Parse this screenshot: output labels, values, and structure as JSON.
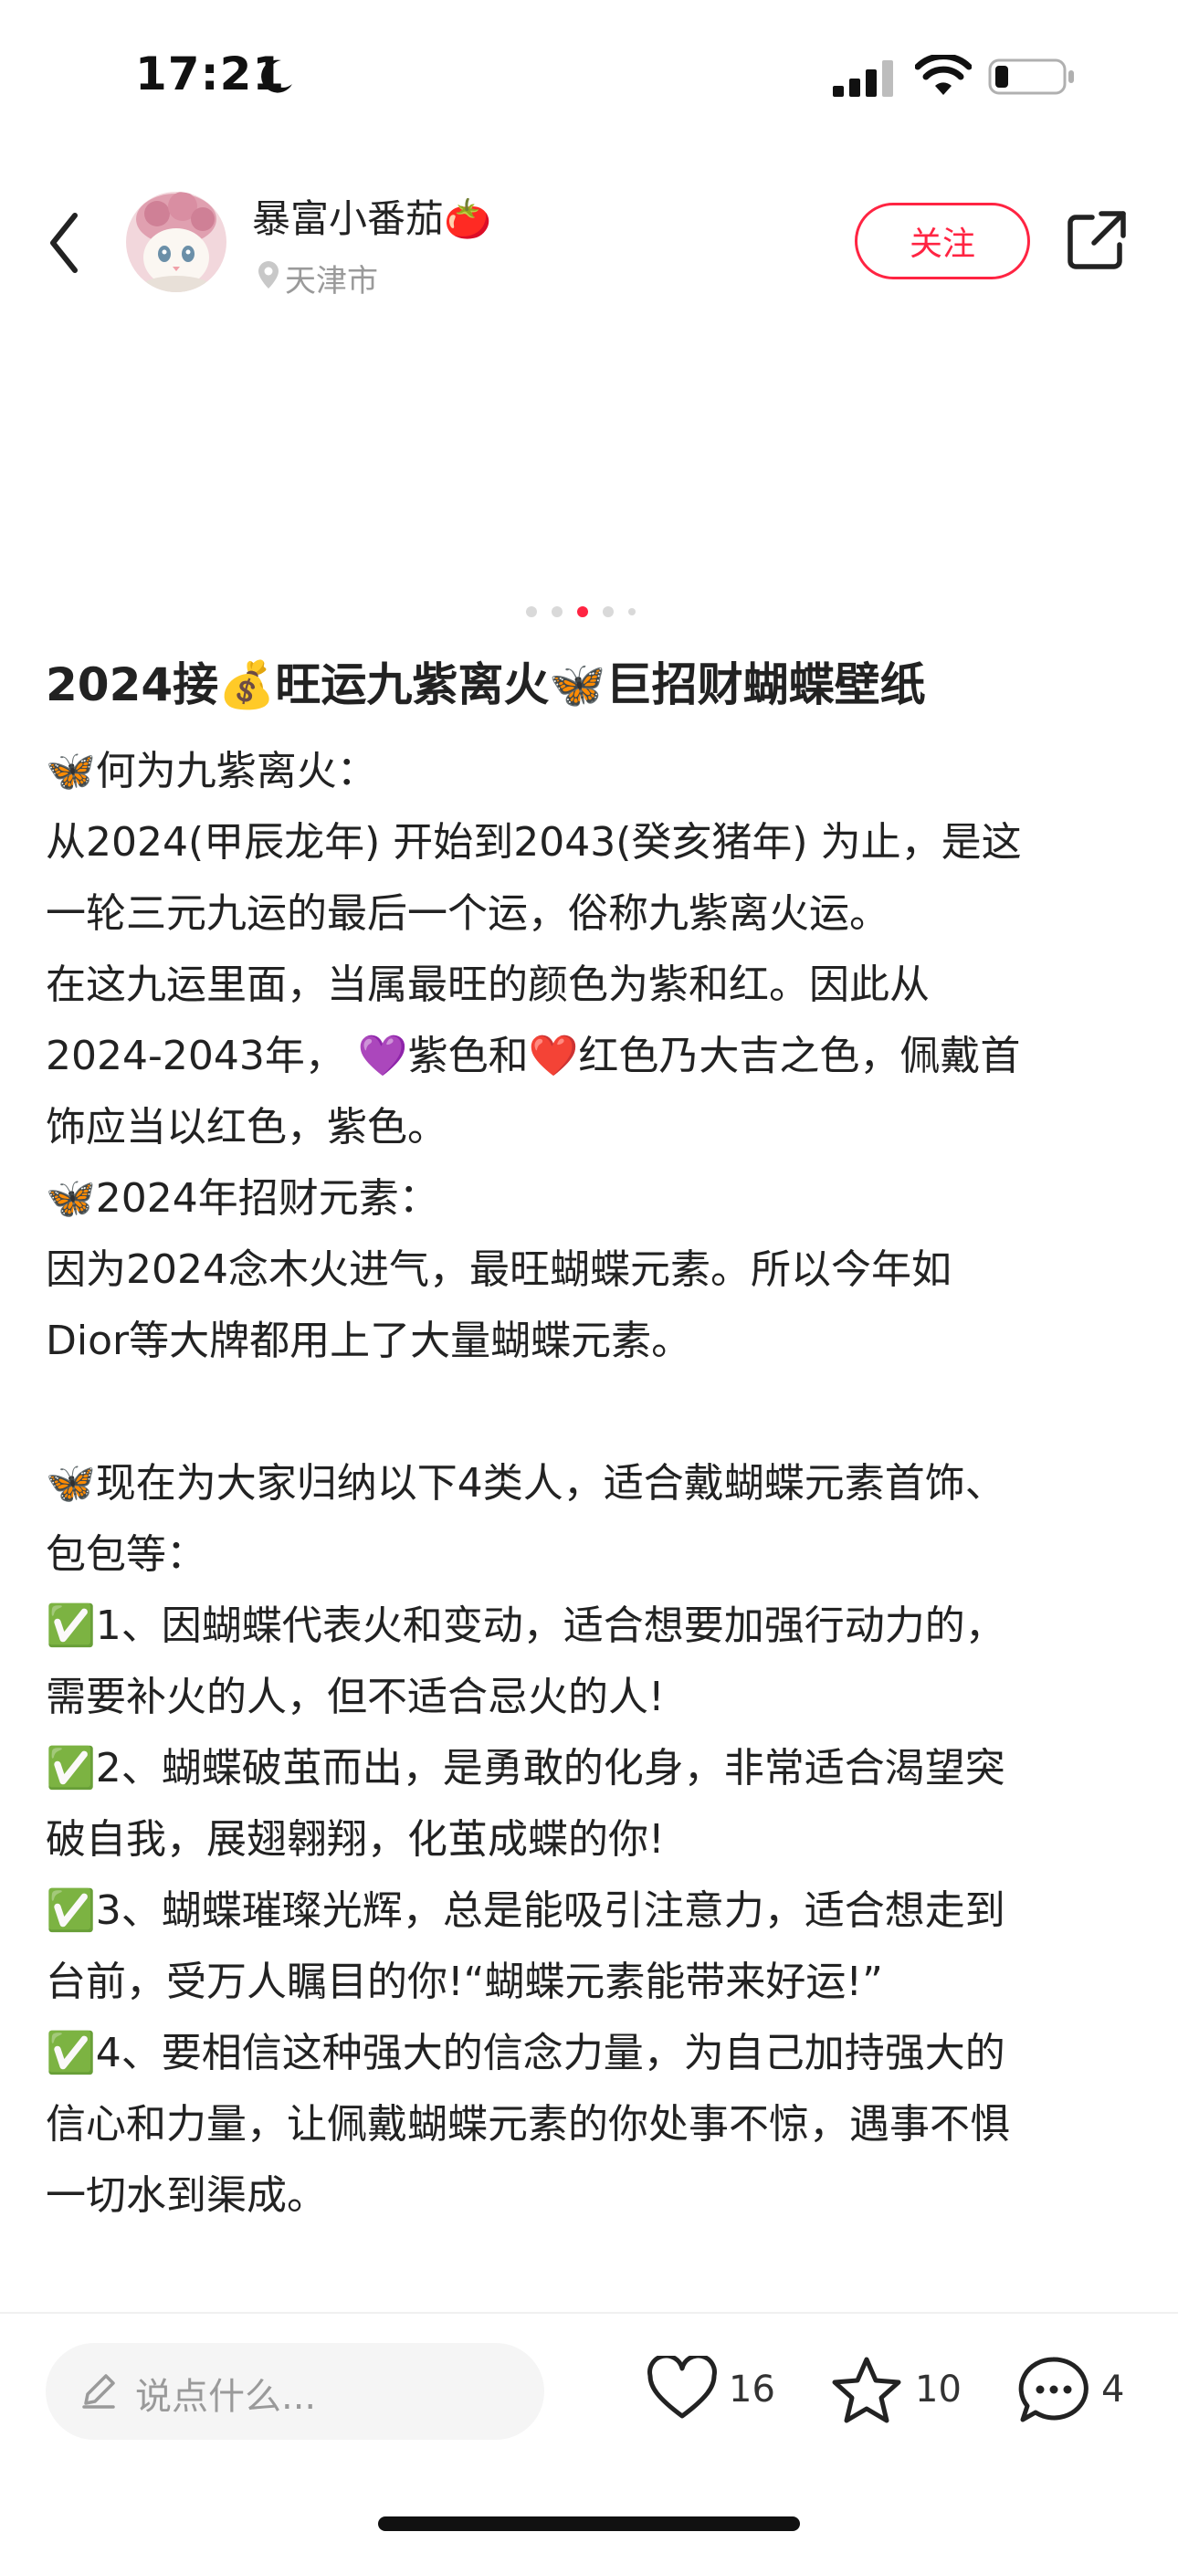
{
  "status_bar": {
    "time": "17:21"
  },
  "author": {
    "name": "暴富小番茄🍅",
    "location": "天津市",
    "follow_label": "关注"
  },
  "carousel": {
    "count": 5,
    "active_index": 2
  },
  "post": {
    "title": "2024接💰旺运九紫离火🦋巨招财蝴蝶壁纸",
    "lines": [
      "🦋何为九紫离火：",
      "从2024(甲辰龙年) 开始到2043(癸亥猪年) 为止，是这",
      "一轮三元九运的最后一个运，俗称九紫离火运。",
      "在这九运里面，当属最旺的颜色为紫和红。因此从",
      " 2024-2043年， 💜紫色和❤️红色乃大吉之色，佩戴首",
      "饰应当以红色，紫色。",
      "🦋2024年招财元素：",
      "因为2024念木火进气，最旺蝴蝶元素。所以今年如",
      " Dior等大牌都用上了大量蝴蝶元素。",
      "",
      "🦋现在为大家归纳以下4类人，适合戴蝴蝶元素首饰、",
      "包包等：",
      "✅1、因蝴蝶代表火和变动，适合想要加强行动力的，",
      "需要补火的人，但不适合忌火的人!",
      "✅2、蝴蝶破茧而出，是勇敢的化身，非常适合渴望突",
      "破自我，展翅翱翔，化茧成蝶的你!",
      "✅3、蝴蝶璀璨光辉，总是能吸引注意力，适合想走到",
      "台前，受万人瞩目的你!“蝴蝶元素能带来好运!”",
      "✅4、要相信这种强大的信念力量，为自己加持强大的",
      "信心和力量，让佩戴蝴蝶元素的你处事不惊，遇事不惧",
      "一切水到渠成。"
    ]
  },
  "bottom_bar": {
    "comment_placeholder": "说点什么...",
    "likes": "16",
    "favorites": "10",
    "comments": "4"
  },
  "colors": {
    "accent": "#ff2442",
    "muted": "#9a9a9a",
    "text": "#222222"
  }
}
